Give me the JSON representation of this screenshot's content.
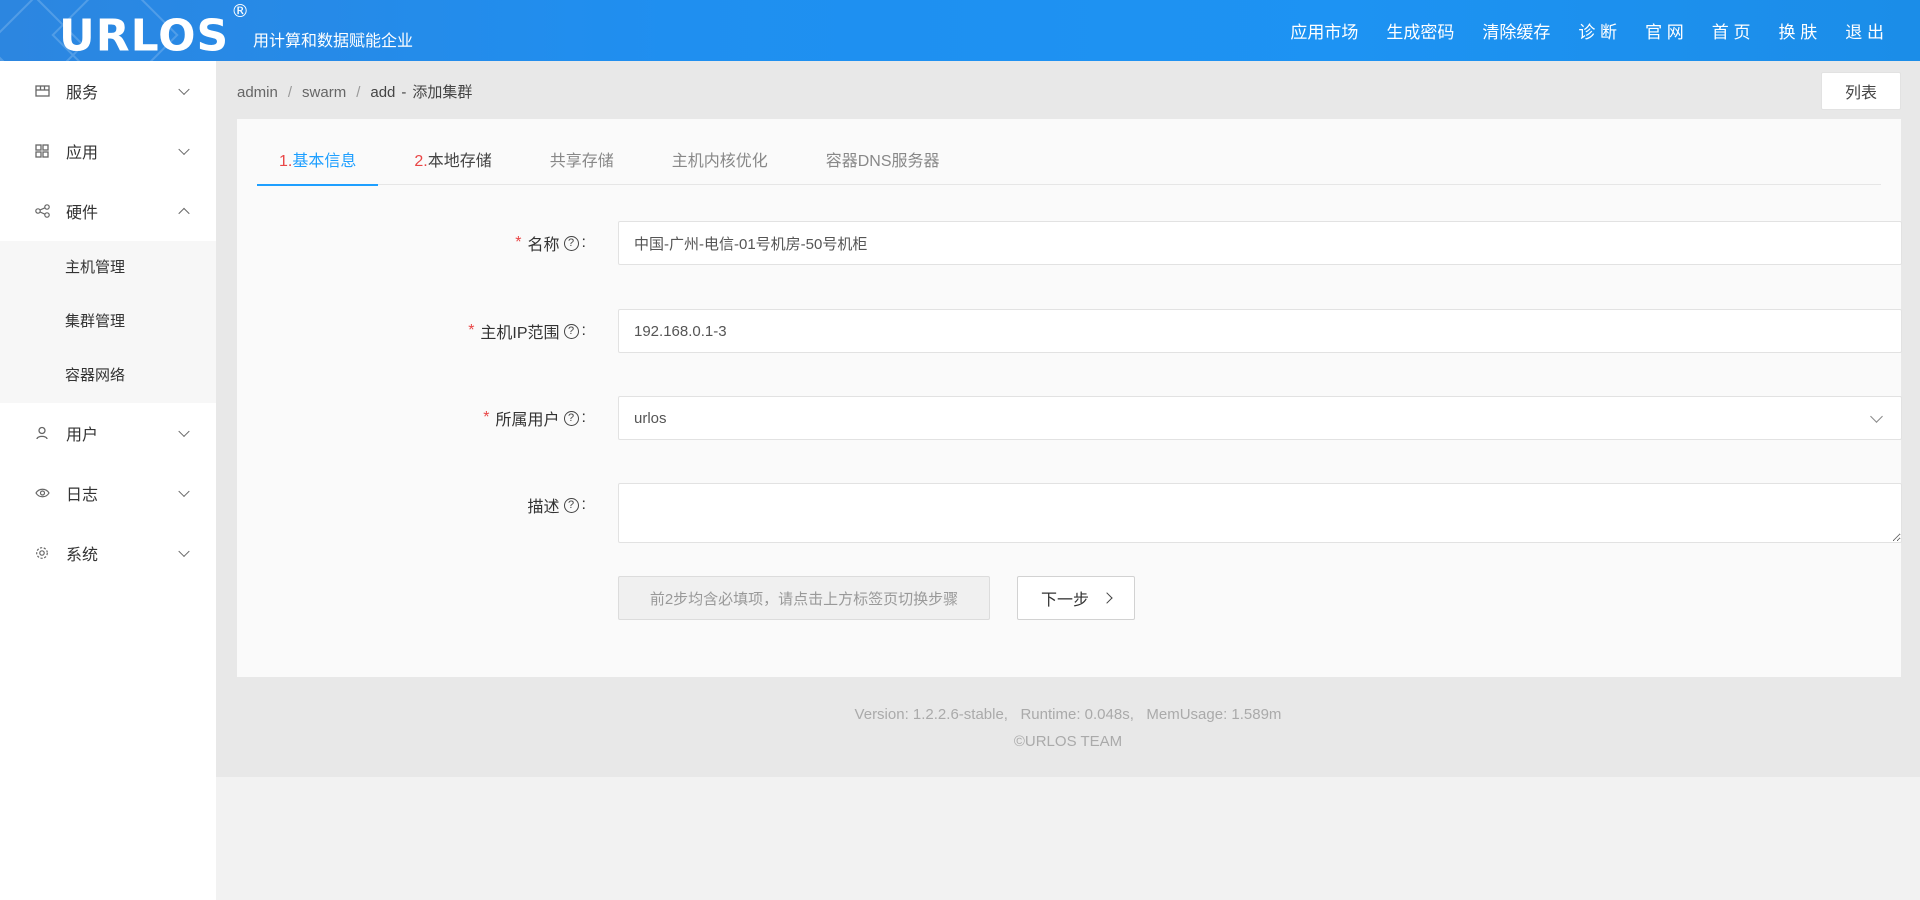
{
  "header": {
    "logo": "URLOS",
    "logo_mark": "®",
    "slogan": "用计算和数据赋能企业",
    "nav": [
      "应用市场",
      "生成密码",
      "清除缓存",
      "诊 断",
      "官 网",
      "首 页",
      "换 肤",
      "退 出"
    ]
  },
  "sidebar": {
    "items": [
      {
        "label": "服务",
        "icon": "service-icon",
        "expanded": false
      },
      {
        "label": "应用",
        "icon": "grid-icon",
        "expanded": false
      },
      {
        "label": "硬件",
        "icon": "share-icon",
        "expanded": true
      },
      {
        "label": "用户",
        "icon": "user-icon",
        "expanded": false
      },
      {
        "label": "日志",
        "icon": "eye-icon",
        "expanded": false
      },
      {
        "label": "系统",
        "icon": "gear-icon",
        "expanded": false
      }
    ],
    "hardware_sub": [
      "主机管理",
      "集群管理",
      "容器网络"
    ]
  },
  "breadcrumb": {
    "parts": [
      "admin",
      "swarm",
      "add"
    ],
    "current": "添加集群"
  },
  "list_button": "列表",
  "tabs": [
    {
      "num": "1.",
      "label": "基本信息",
      "state": "active"
    },
    {
      "num": "2.",
      "label": "本地存储",
      "state": "dark"
    },
    {
      "num": "",
      "label": "共享存储",
      "state": "normal"
    },
    {
      "num": "",
      "label": "主机内核优化",
      "state": "normal"
    },
    {
      "num": "",
      "label": "容器DNS服务器",
      "state": "normal"
    }
  ],
  "form": {
    "name": {
      "label": "名称",
      "value": "中国-广州-电信-01号机房-50号机柜",
      "required": true
    },
    "ip_range": {
      "label": "主机IP范围",
      "value": "192.168.0.1-3",
      "required": true
    },
    "owner": {
      "label": "所属用户",
      "value": "urlos",
      "required": true
    },
    "description": {
      "label": "描述",
      "value": "",
      "required": false
    }
  },
  "buttons": {
    "hint": "前2步均含必填项，请点击上方标签页切换步骤",
    "next": "下一步"
  },
  "footer": {
    "line1": "Version: 1.2.2.6-stable,   Runtime: 0.048s,   MemUsage: 1.589m",
    "line2": "©URLOS TEAM"
  },
  "colors": {
    "header_blue": "#1d8fef",
    "accent": "#1e9fff",
    "required_red": "#e94545"
  }
}
